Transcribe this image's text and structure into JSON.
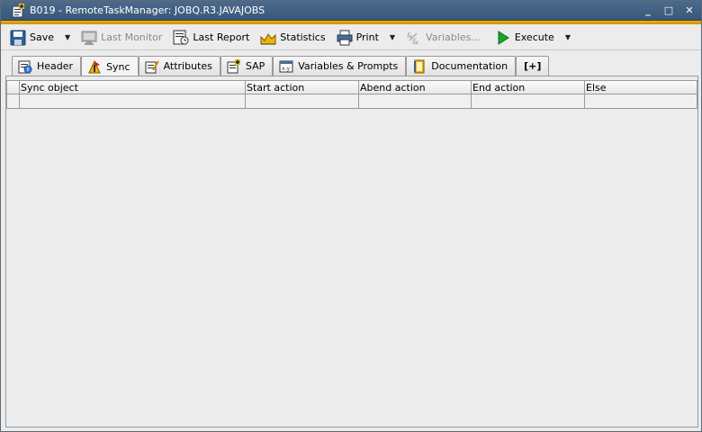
{
  "window": {
    "title": "B019 - RemoteTaskManager: JOBQ.R3.JAVAJOBS",
    "minimize": "_",
    "maximize": "□",
    "close": "✕"
  },
  "toolbar": {
    "save_label": "Save",
    "last_monitor_label": "Last Monitor",
    "last_report_label": "Last Report",
    "statistics_label": "Statistics",
    "print_label": "Print",
    "variables_label": "Variables...",
    "execute_label": "Execute",
    "dropdown_arrow": "▼"
  },
  "tabs": [
    {
      "label": "Header",
      "icon": "header-icon"
    },
    {
      "label": "Sync",
      "icon": "sync-icon",
      "active": true
    },
    {
      "label": "Attributes",
      "icon": "attributes-icon"
    },
    {
      "label": "SAP",
      "icon": "sap-icon"
    },
    {
      "label": "Variables & Prompts",
      "icon": "variables-icon"
    },
    {
      "label": "Documentation",
      "icon": "documentation-icon"
    },
    {
      "label": "[+]",
      "icon": "add-tab-icon"
    }
  ],
  "grid": {
    "columns": [
      "Sync object",
      "Start action",
      "Abend action",
      "End action",
      "Else"
    ],
    "rows": [
      [
        "",
        "",
        "",
        "",
        ""
      ]
    ]
  },
  "colors": {
    "titlebar": "#3f5f82",
    "accent": "#f0b400",
    "execute_green": "#1fa32a"
  }
}
